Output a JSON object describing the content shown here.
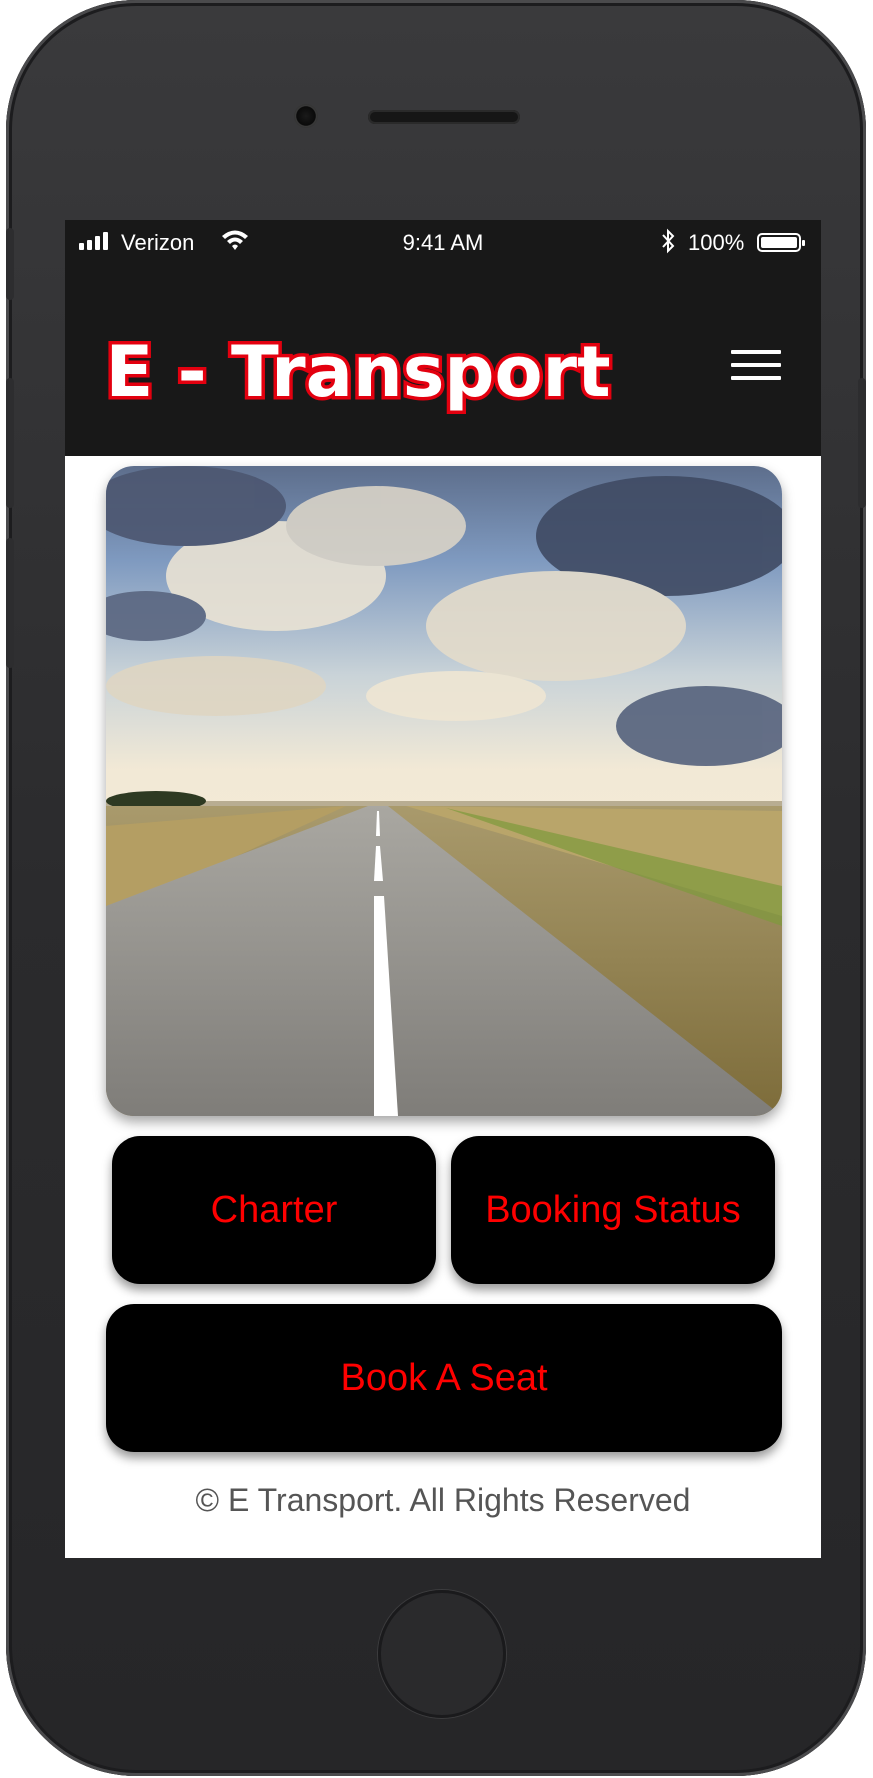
{
  "status_bar": {
    "carrier": "Verizon",
    "time": "9:41 AM",
    "battery": "100%",
    "icons": [
      "signal-icon",
      "wifi-icon",
      "bluetooth-icon",
      "battery-icon"
    ]
  },
  "header": {
    "logo_text": "E - Transport",
    "menu_icon": "hamburger-menu-icon"
  },
  "hero": {
    "image": "open-road-under-cloudy-sky"
  },
  "buttons": {
    "charter": "Charter",
    "booking_status": "Booking Status",
    "book_seat": "Book A Seat"
  },
  "footer": {
    "text": "© E Transport. All Rights Reserved"
  },
  "colors": {
    "header_bg": "#181818",
    "button_bg": "#000000",
    "button_text": "#ff0000",
    "logo_fill": "#ffffff",
    "logo_outline": "#e3000f"
  }
}
